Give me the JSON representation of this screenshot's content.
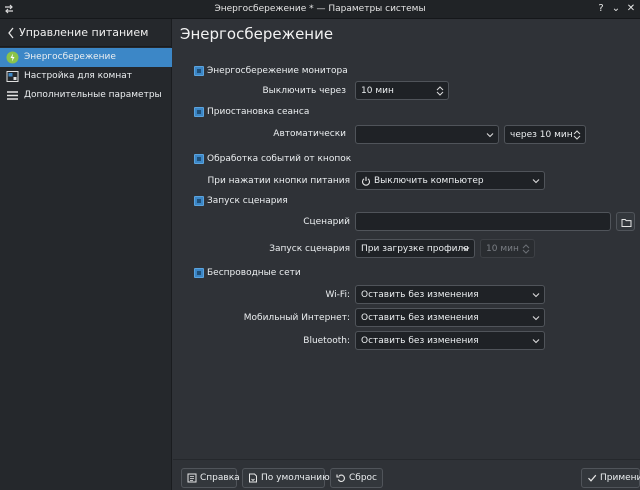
{
  "window": {
    "title": "Энергосбережение * — Параметры системы",
    "help_glyph": "?",
    "minimize_glyph": "⌄",
    "close_glyph": "✕"
  },
  "sidebar": {
    "header": "Управление питанием",
    "items": [
      {
        "label": "Энергосбережение",
        "icon": "battery-icon",
        "active": true
      },
      {
        "label": "Настройка для комнат",
        "icon": "activities-icon",
        "active": false
      },
      {
        "label": "Дополнительные параметры",
        "icon": "menu-icon",
        "active": false
      }
    ]
  },
  "main": {
    "title": "Энергосбережение",
    "monitor": {
      "checkbox_label": "Энергосбережение монитора",
      "checked": true,
      "turn_off_label": "Выключить через",
      "turn_off_value": "10 мин"
    },
    "session": {
      "checkbox_label": "Приостановка сеанса",
      "checked": true,
      "auto_label": "Автоматически",
      "auto_value": "",
      "delay_value": "через 10 мин"
    },
    "buttons_events": {
      "checkbox_label": "Обработка событий от кнопок",
      "checked": true,
      "power_button_label": "При нажатии кнопки питания",
      "power_button_value": "Выключить компьютер"
    },
    "script": {
      "checkbox_label": "Запуск сценария",
      "checked": true,
      "script_label": "Сценарий",
      "script_value": "",
      "run_label": "Запуск сценария",
      "run_value": "При загрузке профиля",
      "run_delay_value": "10 мин"
    },
    "wireless": {
      "checkbox_label": "Беспроводные сети",
      "checked": true,
      "wifi_label": "Wi-Fi:",
      "wifi_value": "Оставить без изменения",
      "mobile_label": "Мобильный Интернет:",
      "mobile_value": "Оставить без изменения",
      "bluetooth_label": "Bluetooth:",
      "bluetooth_value": "Оставить без изменения"
    }
  },
  "footer": {
    "help_label": "Справка",
    "defaults_label": "По умолчанию",
    "reset_label": "Сброс",
    "apply_label": "Применить"
  },
  "colors": {
    "accent": "#3c87c7",
    "window_bg": "#2f3237",
    "sidebar_bg": "#25282c"
  }
}
